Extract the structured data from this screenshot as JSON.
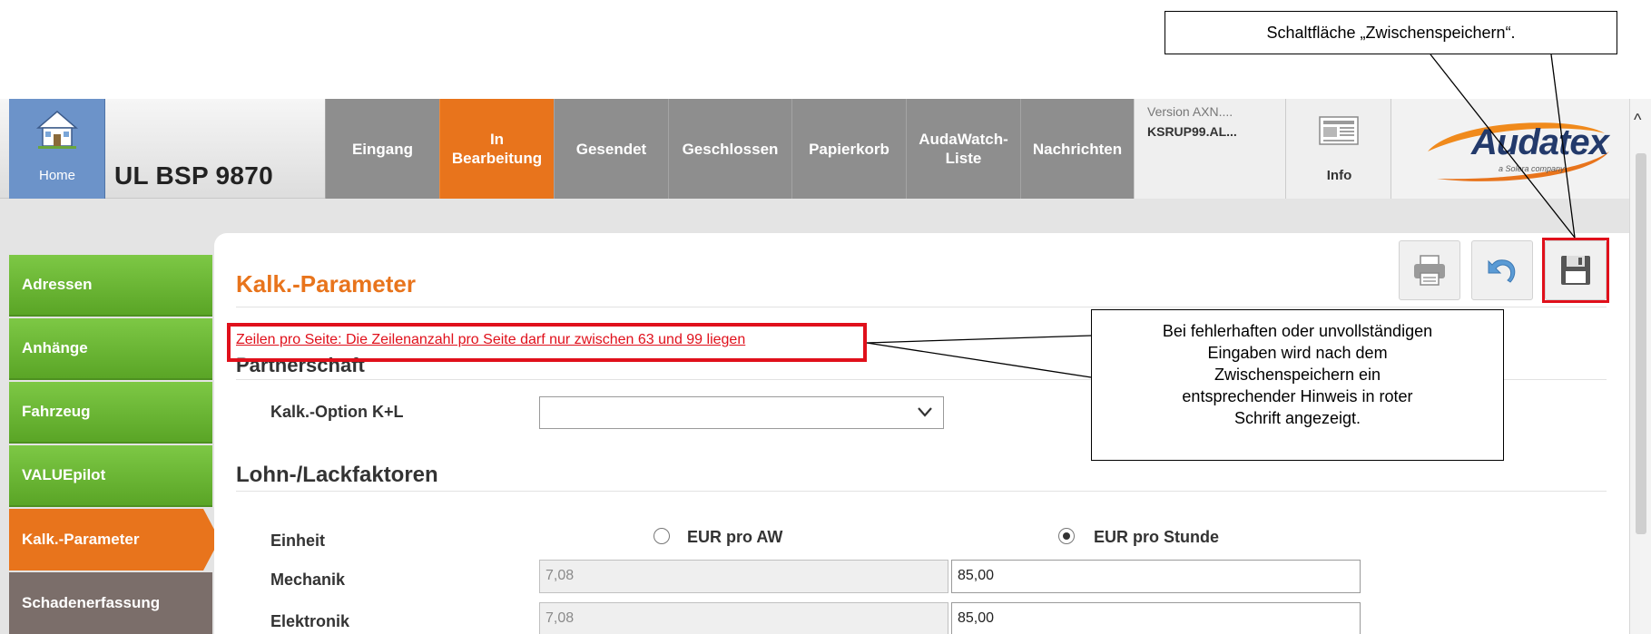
{
  "header": {
    "home_label": "Home",
    "case_title": "UL BSP 9870",
    "tabs": [
      {
        "label_line1": "Eingang",
        "label_line2": ""
      },
      {
        "label_line1": "In",
        "label_line2": "Bearbeitung"
      },
      {
        "label_line1": "Gesendet",
        "label_line2": ""
      },
      {
        "label_line1": "Geschlossen",
        "label_line2": ""
      },
      {
        "label_line1": "Papierkorb",
        "label_line2": ""
      },
      {
        "label_line1": "AudaWatch-",
        "label_line2": "Liste"
      },
      {
        "label_line1": "Nachrichten",
        "label_line2": ""
      }
    ],
    "active_tab": "In Bearbeitung",
    "version_line1": "Version AXN....",
    "version_line2": "KSRUP99.AL...",
    "info_label": "Info",
    "logo_text": "Audatex",
    "logo_sub": "a Solera company"
  },
  "sidebar": {
    "items": [
      {
        "label": "Adressen",
        "state": "normal"
      },
      {
        "label": "Anhänge",
        "state": "normal"
      },
      {
        "label": "Fahrzeug",
        "state": "normal"
      },
      {
        "label": "VALUEpilot",
        "state": "normal"
      },
      {
        "label": "Kalk.-Parameter",
        "state": "active"
      },
      {
        "label": "Schadenerfassung",
        "state": "normal"
      }
    ]
  },
  "toolbar": {
    "print_icon": "printer-icon",
    "undo_icon": "undo-icon",
    "save_icon": "floppy-disk-icon"
  },
  "main": {
    "page_title": "Kalk.-Parameter",
    "error_message": "Zeilen pro Seite: Die Zeilenanzahl pro Seite darf nur zwischen 63 und 99 liegen",
    "partner_section_title": "Partnerschaft",
    "kalk_option_label": "Kalk.-Option K+L",
    "kalk_option_value": "",
    "lohn_section_title": "Lohn-/Lackfaktoren",
    "einheit_label": "Einheit",
    "unit_options": [
      {
        "label": "EUR pro AW",
        "checked": false
      },
      {
        "label": "EUR pro Stunde",
        "checked": true
      }
    ],
    "rows": [
      {
        "label": "Mechanik",
        "aw_value": "7,08",
        "stunde_value": "85,00"
      },
      {
        "label": "Elektronik",
        "aw_value": "7,08",
        "stunde_value": "85,00"
      }
    ]
  },
  "annotations": {
    "save_callout": "Schaltfläche „Zwischenspeichern“.",
    "error_callout_lines": [
      "Bei fehlerhaften oder unvollständigen",
      "Eingaben wird nach dem",
      "Zwischenspeichern ein",
      "entsprechender  Hinweis in roter",
      "Schrift angezeigt."
    ]
  },
  "colors": {
    "active_orange": "#e8741c",
    "sidebar_green": "#6cb634",
    "error_red": "#e0101b",
    "home_blue": "#6c93c9",
    "tab_gray": "#8e8e8e"
  }
}
